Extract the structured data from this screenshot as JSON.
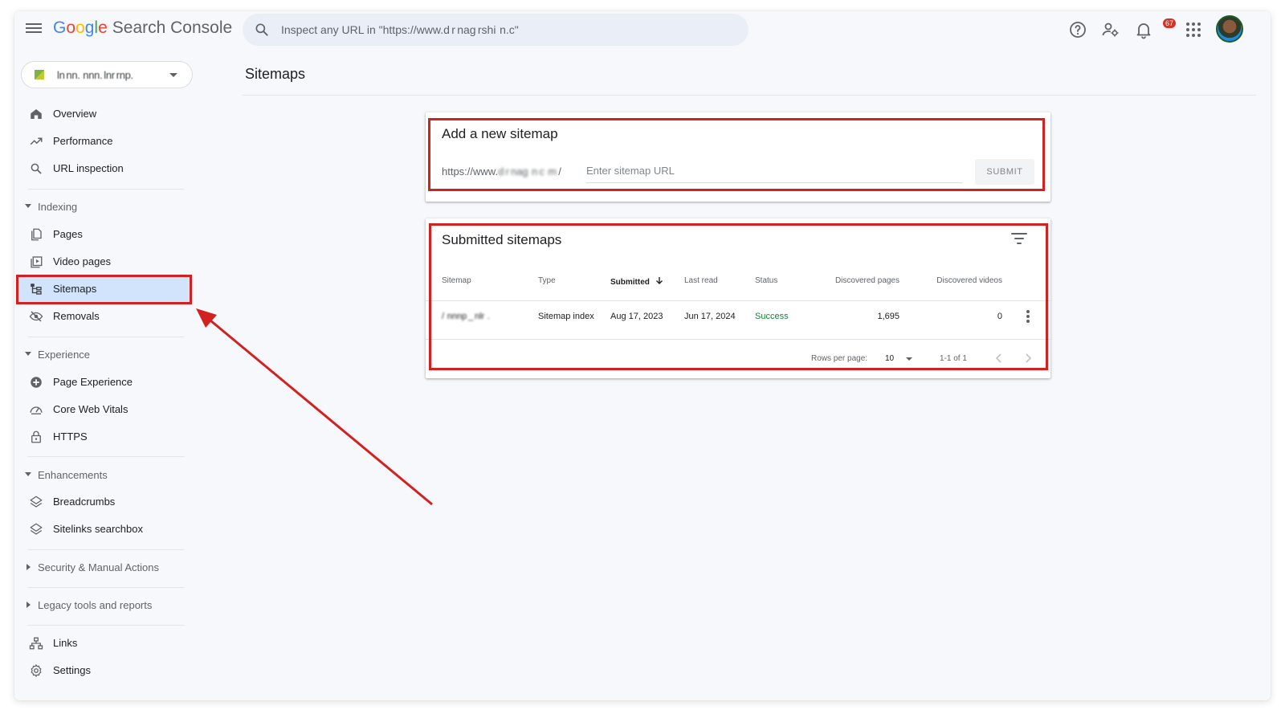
{
  "app": {
    "title_letters": [
      "G",
      "o",
      "o",
      "g",
      "l",
      "e"
    ],
    "product": "Search Console"
  },
  "search": {
    "placeholder": "Inspect any URL in \"https://www.d r nag rshi  n.c\""
  },
  "header": {
    "notification_count": "67",
    "icons": [
      "help-icon",
      "manage-users-icon",
      "notifications-icon",
      "apps-grid-icon",
      "account-avatar"
    ]
  },
  "property": {
    "name": "ln nn.  nnn. lnr rnp."
  },
  "sidebar": {
    "top": [
      {
        "label": "Overview",
        "icon": "home-icon"
      },
      {
        "label": "Performance",
        "icon": "trending-up-icon"
      },
      {
        "label": "URL inspection",
        "icon": "search-icon"
      }
    ],
    "sections": [
      {
        "label": "Indexing",
        "expanded": true
      },
      {
        "label": "Experience",
        "expanded": true
      },
      {
        "label": "Enhancements",
        "expanded": true
      },
      {
        "label": "Security & Manual Actions",
        "expanded": false
      },
      {
        "label": "Legacy tools and reports",
        "expanded": false
      }
    ],
    "indexing": [
      {
        "label": "Pages",
        "icon": "pages-icon"
      },
      {
        "label": "Video pages",
        "icon": "video-pages-icon"
      },
      {
        "label": "Sitemaps",
        "icon": "sitemap-icon",
        "active": true
      },
      {
        "label": "Removals",
        "icon": "visibility-off-icon"
      }
    ],
    "experience": [
      {
        "label": "Page Experience",
        "icon": "plus-circle-icon"
      },
      {
        "label": "Core Web Vitals",
        "icon": "speed-gauge-icon"
      },
      {
        "label": "HTTPS",
        "icon": "lock-icon"
      }
    ],
    "enhancements": [
      {
        "label": "Breadcrumbs",
        "icon": "layers-icon"
      },
      {
        "label": "Sitelinks searchbox",
        "icon": "layers-icon"
      }
    ],
    "bottom": [
      {
        "label": "Links",
        "icon": "links-icon"
      },
      {
        "label": "Settings",
        "icon": "gear-icon"
      }
    ]
  },
  "page": {
    "title": "Sitemaps"
  },
  "add_sitemap": {
    "title": "Add a new sitemap",
    "url_prefix_start": "https://www.",
    "url_prefix_blurred": "d r nag  n c  m",
    "url_prefix_end": " /",
    "input_placeholder": "Enter sitemap URL",
    "submit_label": "SUBMIT"
  },
  "submitted": {
    "title": "Submitted sitemaps",
    "columns": [
      "Sitemap",
      "Type",
      "Submitted",
      "Last read",
      "Status",
      "Discovered pages",
      "Discovered videos"
    ],
    "rows": [
      {
        "sitemap": "/  nnnp _ nlr  . ",
        "type": "Sitemap index",
        "submitted": "Aug 17, 2023",
        "last_read": "Jun 17, 2024",
        "status": "Success",
        "discovered_pages": "1,695",
        "discovered_videos": "0"
      }
    ],
    "pagination": {
      "rows_per_page_label": "Rows per page:",
      "rows_per_page": "10",
      "range": "1-1 of 1"
    }
  },
  "colors": {
    "highlight": "#d32020",
    "active_nav": "#d2e3fc",
    "success": "#188038"
  }
}
